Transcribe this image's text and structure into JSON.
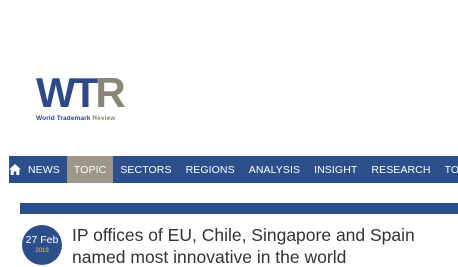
{
  "logo": {
    "letters": [
      "W",
      "T",
      "R"
    ],
    "subtitle_main": "World Trademark ",
    "subtitle_accent": "Review",
    "colors": {
      "primary": "#2d4a86",
      "accent": "#8a8675"
    }
  },
  "nav": {
    "home_icon": "home-icon",
    "items": [
      {
        "label": "NEWS",
        "active": false
      },
      {
        "label": "TOPIC",
        "active": true
      },
      {
        "label": "SECTORS",
        "active": false
      },
      {
        "label": "REGIONS",
        "active": false
      },
      {
        "label": "ANALYSIS",
        "active": false
      },
      {
        "label": "INSIGHT",
        "active": false
      },
      {
        "label": "RESEARCH",
        "active": false
      },
      {
        "label": "TOP",
        "active": false
      }
    ],
    "colors": {
      "bar": "#2c4f8c",
      "active": "#9c9787"
    }
  },
  "article": {
    "date_day": "27 Feb",
    "date_year": "2019",
    "headline": "IP offices of EU, Chile, Singapore and Spain named most innovative in the world"
  }
}
